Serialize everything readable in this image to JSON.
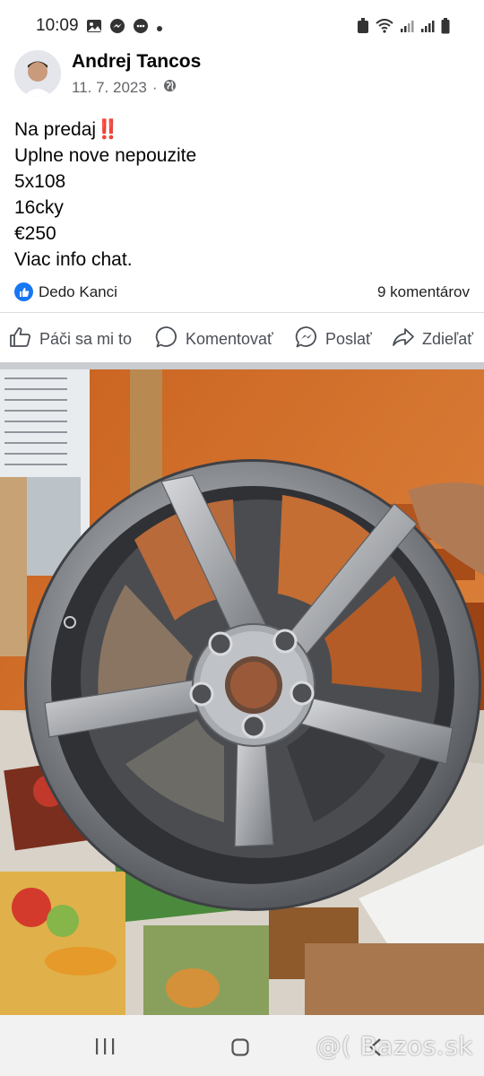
{
  "status_bar": {
    "time": "10:09",
    "left_icons": [
      "gallery-icon",
      "messenger-icon",
      "chat-bubble-icon",
      "dot-icon"
    ],
    "right_icons": [
      "alarm-icon",
      "wifi-icon",
      "signal-icon",
      "signal-r-icon",
      "battery-icon"
    ]
  },
  "post": {
    "author": "Andrej Tancos",
    "date": "11. 7. 2023",
    "date_separator": "·",
    "privacy_icon": "globe-icon",
    "lines": [
      "Na predaj‼️",
      "Uplne nove nepouzite",
      "5x108",
      "16cky",
      "€250",
      "Viac info chat."
    ],
    "reactor": "Dedo Kanci",
    "comments": "9 komentárov"
  },
  "actions": {
    "like": "Páči sa mi to",
    "comment": "Komentovať",
    "send": "Poslať",
    "share": "Zdieľať"
  },
  "colors": {
    "accent": "#1877f2",
    "wall": "#d2732e",
    "rim": "#8a8c90"
  },
  "watermark": "@( Bazos.sk"
}
